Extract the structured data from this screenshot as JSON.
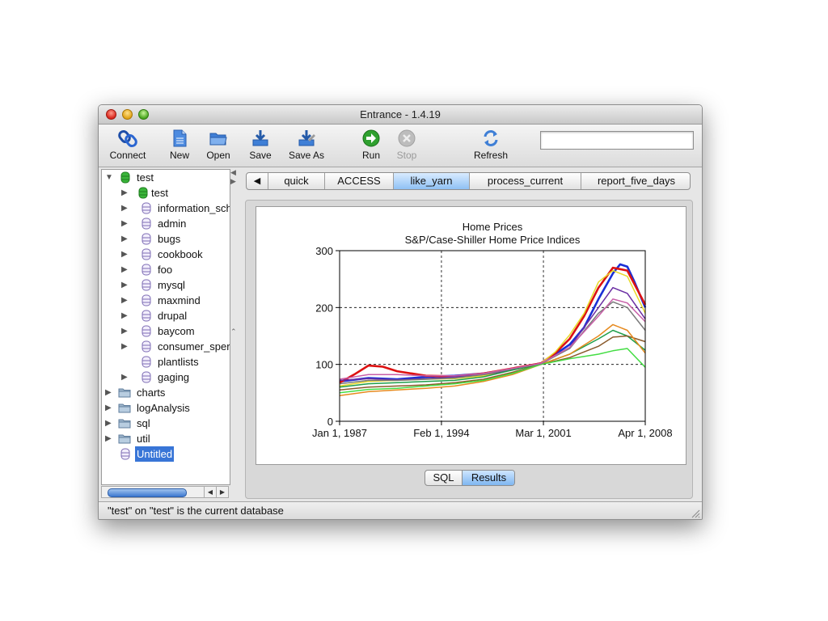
{
  "window": {
    "title": "Entrance - 1.4.19"
  },
  "toolbar": {
    "connect": "Connect",
    "new": "New",
    "open": "Open",
    "save": "Save",
    "save_as": "Save As",
    "run": "Run",
    "stop": "Stop",
    "refresh": "Refresh",
    "search_value": ""
  },
  "tree": {
    "root": "test",
    "children": [
      "test",
      "information_sch",
      "admin",
      "bugs",
      "cookbook",
      "foo",
      "mysql",
      "maxmind",
      "drupal",
      "baycom",
      "consumer_sper",
      "plantlists",
      "gaging"
    ],
    "folders": [
      "charts",
      "logAnalysis",
      "sql",
      "util"
    ],
    "untitled": "Untitled"
  },
  "tabs": [
    "quick",
    "ACCESS",
    "like_yarn",
    "process_current",
    "report_five_days"
  ],
  "active_tab": "like_yarn",
  "view_toggle": {
    "sql": "SQL",
    "results": "Results",
    "active": "Results"
  },
  "status": "\"test\" on \"test\" is the current database",
  "chart_data": {
    "type": "line",
    "title": "Home Prices",
    "subtitle": "S&P/Case-Shiller Home Price Indices",
    "xlabel": "",
    "ylabel": "",
    "x_ticks": [
      "Jan 1, 1987",
      "Feb 1, 1994",
      "Mar 1, 2001",
      "Apr 1, 2008"
    ],
    "y_ticks": [
      0,
      100,
      200,
      300
    ],
    "ylim": [
      0,
      300
    ],
    "xlim": [
      1987.0,
      2008.25
    ],
    "grid": true,
    "legend": "none",
    "series": [
      {
        "color": "#1a2fd6",
        "x": [
          1987.0,
          1989,
          1991,
          1993,
          1995,
          1997,
          1999,
          2001,
          2002,
          2003,
          2004,
          2005,
          2006,
          2006.5,
          2007,
          2007.5,
          2008.25
        ],
        "values": [
          70,
          76,
          74,
          78,
          80,
          84,
          92,
          102,
          118,
          135,
          165,
          215,
          260,
          276,
          272,
          245,
          200
        ]
      },
      {
        "color": "#dd1111",
        "x": [
          1987.0,
          1988,
          1989,
          1990,
          1991,
          1993,
          1995,
          1997,
          1999,
          2001,
          2002,
          2003,
          2004,
          2005,
          2006,
          2007,
          2008.25
        ],
        "values": [
          68,
          82,
          98,
          96,
          88,
          80,
          79,
          84,
          93,
          102,
          120,
          145,
          185,
          235,
          270,
          265,
          205
        ]
      },
      {
        "color": "#e8d928",
        "x": [
          1987.0,
          1989,
          1991,
          1993,
          1995,
          1997,
          1999,
          2001,
          2002,
          2003,
          2004,
          2005,
          2006,
          2007,
          2008.25
        ],
        "values": [
          62,
          70,
          72,
          74,
          75,
          80,
          90,
          102,
          122,
          152,
          190,
          245,
          265,
          255,
          190
        ]
      },
      {
        "color": "#6b2ea3",
        "x": [
          1987.0,
          1989,
          1991,
          1993,
          1995,
          1997,
          1999,
          2001,
          2003,
          2005,
          2006,
          2007,
          2008.25
        ],
        "values": [
          72,
          75,
          73,
          75,
          78,
          82,
          90,
          101,
          130,
          200,
          235,
          225,
          180
        ]
      },
      {
        "color": "#1f9e4a",
        "x": [
          1987.0,
          1989,
          1991,
          1993,
          1995,
          1997,
          1999,
          2001,
          2003,
          2005,
          2006,
          2007,
          2008.25
        ],
        "values": [
          60,
          66,
          68,
          70,
          72,
          78,
          90,
          100,
          118,
          145,
          160,
          150,
          125
        ]
      },
      {
        "color": "#8a5a2b",
        "x": [
          1987.0,
          1989,
          1991,
          1993,
          1995,
          1997,
          1999,
          2001,
          2003,
          2005,
          2006,
          2007,
          2008.25
        ],
        "values": [
          55,
          60,
          62,
          64,
          68,
          74,
          86,
          100,
          112,
          132,
          148,
          150,
          140
        ]
      },
      {
        "color": "#e68a1e",
        "x": [
          1987.0,
          1989,
          1991,
          1993,
          1995,
          1997,
          1999,
          2001,
          2003,
          2005,
          2006,
          2007,
          2008.25
        ],
        "values": [
          45,
          52,
          55,
          58,
          62,
          70,
          82,
          100,
          118,
          150,
          170,
          160,
          120
        ]
      },
      {
        "color": "#44dd44",
        "x": [
          1987.0,
          1989,
          1991,
          1993,
          1995,
          1997,
          1999,
          2001,
          2003,
          2005,
          2006,
          2007,
          2008.25
        ],
        "values": [
          50,
          56,
          58,
          62,
          66,
          72,
          84,
          100,
          110,
          118,
          124,
          128,
          95
        ]
      },
      {
        "color": "#7a7a7a",
        "x": [
          1987.0,
          1989,
          1991,
          1993,
          1995,
          1997,
          1999,
          2001,
          2003,
          2005,
          2006,
          2007,
          2008.25
        ],
        "values": [
          66,
          72,
          72,
          74,
          76,
          82,
          92,
          101,
          128,
          190,
          210,
          200,
          160
        ]
      },
      {
        "color": "#c85fa8",
        "x": [
          1987.0,
          1989,
          1991,
          1993,
          1995,
          1997,
          1999,
          2001,
          2003,
          2005,
          2006,
          2007,
          2008.25
        ],
        "values": [
          74,
          82,
          82,
          80,
          80,
          84,
          93,
          102,
          130,
          185,
          215,
          208,
          175
        ]
      }
    ]
  }
}
